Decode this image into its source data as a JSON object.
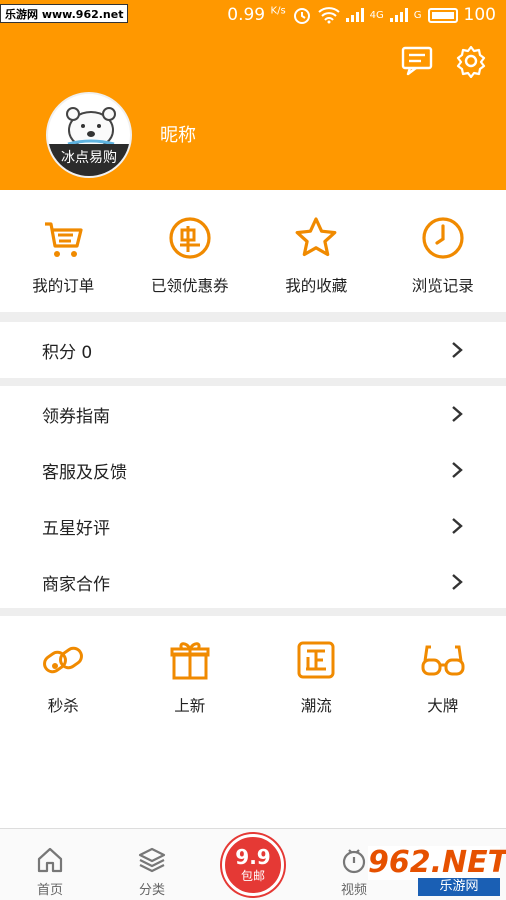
{
  "statusbar": {
    "watermark": "乐游网 www.962.net",
    "speed": "0.99",
    "speed_unit": "K/s",
    "network_tag": "4G",
    "network_tag2": "G",
    "battery": "100"
  },
  "header": {
    "nickname": "昵称",
    "avatar_text": "冰点易购"
  },
  "quick_actions": [
    {
      "label": "我的订单",
      "icon": "cart-icon"
    },
    {
      "label": "已领优惠券",
      "icon": "coupon-icon"
    },
    {
      "label": "我的收藏",
      "icon": "star-icon"
    },
    {
      "label": "浏览记录",
      "icon": "clock-icon"
    }
  ],
  "points": {
    "label": "积分 0"
  },
  "menu": [
    {
      "label": "领券指南"
    },
    {
      "label": "客服及反馈"
    },
    {
      "label": "五星好评"
    },
    {
      "label": "商家合作"
    }
  ],
  "features": [
    {
      "label": "秒杀",
      "icon": "flash-sale-icon"
    },
    {
      "label": "上新",
      "icon": "gift-icon"
    },
    {
      "label": "潮流",
      "icon": "trend-icon"
    },
    {
      "label": "大牌",
      "icon": "glasses-icon"
    }
  ],
  "tabbar": {
    "home": "首页",
    "category": "分类",
    "center_top": "9.9",
    "center_bottom": "包邮",
    "video": "视频"
  },
  "watermark_br": {
    "top": "962.NET",
    "bottom": "乐游网"
  },
  "colors": {
    "accent": "#ff9800",
    "icon": "#f08a00",
    "badge": "#e53935"
  }
}
